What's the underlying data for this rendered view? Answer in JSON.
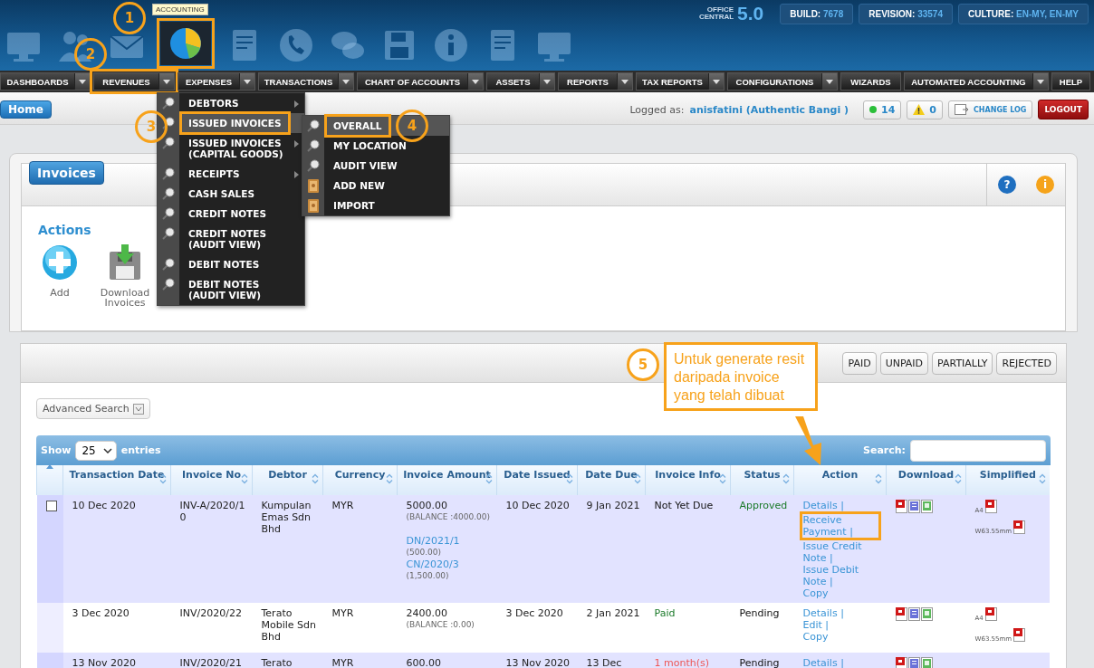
{
  "header": {
    "apps": [
      {
        "kind": "monitor",
        "selected": false
      },
      {
        "kind": "people",
        "selected": false
      },
      {
        "kind": "mail",
        "selected": false
      },
      {
        "kind": "pie",
        "selected": true,
        "tooltip": "ACCOUNTING",
        "outlined": true
      },
      {
        "kind": "document",
        "selected": false
      },
      {
        "kind": "phone",
        "selected": false
      },
      {
        "kind": "chat",
        "selected": false
      },
      {
        "kind": "disk",
        "selected": false
      },
      {
        "kind": "info",
        "selected": false
      },
      {
        "kind": "document",
        "selected": false
      },
      {
        "kind": "monitor",
        "selected": false
      }
    ],
    "product": {
      "line1": "OFFICE",
      "line2": "CENTRAL",
      "version": "5.0"
    },
    "badges": [
      {
        "label": "BUILD:",
        "value": "7678"
      },
      {
        "label": "REVISION:",
        "value": "33574"
      },
      {
        "label": "CULTURE:",
        "value": "EN-MY, EN-MY"
      }
    ]
  },
  "nav": [
    {
      "label": "DASHBOARDS",
      "dropdown": true,
      "outlined": false
    },
    {
      "label": "REVENUES",
      "dropdown": true,
      "outlined": true
    },
    {
      "label": "EXPENSES",
      "dropdown": true,
      "outlined": false
    },
    {
      "label": "TRANSACTIONS",
      "dropdown": true,
      "outlined": false
    },
    {
      "label": "CHART OF ACCOUNTS",
      "dropdown": true,
      "outlined": false
    },
    {
      "label": "ASSETS",
      "dropdown": true,
      "outlined": false
    },
    {
      "label": "REPORTS",
      "dropdown": true,
      "outlined": false
    },
    {
      "label": "TAX REPORTS",
      "dropdown": true,
      "outlined": false
    },
    {
      "label": "CONFIGURATIONS",
      "dropdown": true,
      "outlined": false
    },
    {
      "label": "WIZARDS",
      "dropdown": false,
      "outlined": false
    },
    {
      "label": "AUTOMATED ACCOUNTING",
      "dropdown": true,
      "outlined": false
    },
    {
      "label": "HELP",
      "dropdown": false,
      "outlined": false
    }
  ],
  "revenues_menu": [
    {
      "label": "DEBTORS",
      "submenu": true,
      "highlighted": false,
      "outlined": false
    },
    {
      "label": "ISSUED INVOICES",
      "submenu": false,
      "highlighted": true,
      "outlined": true
    },
    {
      "label": "ISSUED INVOICES (CAPITAL GOODS)",
      "submenu": true,
      "highlighted": false,
      "outlined": false
    },
    {
      "label": "RECEIPTS",
      "submenu": true,
      "highlighted": false,
      "outlined": false
    },
    {
      "label": "CASH SALES",
      "submenu": false,
      "highlighted": false,
      "outlined": false
    },
    {
      "label": "CREDIT NOTES",
      "submenu": false,
      "highlighted": false,
      "outlined": false
    },
    {
      "label": "CREDIT NOTES (AUDIT VIEW)",
      "submenu": false,
      "highlighted": false,
      "outlined": false
    },
    {
      "label": "DEBIT NOTES",
      "submenu": false,
      "highlighted": false,
      "outlined": false
    },
    {
      "label": "DEBIT NOTES (AUDIT VIEW)",
      "submenu": false,
      "highlighted": false,
      "outlined": false
    }
  ],
  "issued_invoices_menu": [
    {
      "label": "OVERALL",
      "kind": "search",
      "highlighted": true,
      "outlined": true
    },
    {
      "label": "MY LOCATION",
      "kind": "search",
      "highlighted": false,
      "outlined": false
    },
    {
      "label": "AUDIT VIEW",
      "kind": "search",
      "highlighted": false,
      "outlined": false
    },
    {
      "label": "ADD NEW",
      "kind": "book",
      "highlighted": false,
      "outlined": false
    },
    {
      "label": "IMPORT",
      "kind": "book",
      "highlighted": false,
      "outlined": false
    }
  ],
  "subbar": {
    "home": "Home",
    "logged_label": "Logged as:",
    "user": "anisfatini (Authentic Bangi )",
    "counters": [
      {
        "kind": "ok",
        "value": "14"
      },
      {
        "kind": "warning",
        "value": "0"
      }
    ],
    "change_log": "CHANGE LOG",
    "logout": "LOGOUT"
  },
  "invoices_panel": {
    "title": "Invoices",
    "help_buttons": [
      {
        "kind": "help",
        "glyph": "?"
      },
      {
        "kind": "info",
        "glyph": "i"
      }
    ],
    "actions_title": "Actions",
    "actions": [
      {
        "kind": "add",
        "label": "Add"
      },
      {
        "kind": "download",
        "label": "Download Invoices"
      }
    ]
  },
  "filters": [
    "PAID",
    "UNPAID",
    "PARTIALLY",
    "REJECTED"
  ],
  "advanced_search": "Advanced Search",
  "table": {
    "show_label": "Show",
    "page_size": "25",
    "entries_label": "entries",
    "search_label": "Search:",
    "columns": [
      "Transaction Date",
      "Invoice No",
      "Debtor",
      "Currency",
      "Invoice Amount",
      "Date Issued",
      "Date Due",
      "Invoice Info",
      "Status",
      "Action",
      "Download",
      "Simplified"
    ],
    "rows": [
      {
        "checked": false,
        "transaction_date": "10 Dec 2020",
        "invoice_no": "INV-A/2020/10",
        "debtor": "Kumpulan Emas Sdn Bhd",
        "currency": "MYR",
        "amount": "5000.00",
        "balance": "(BALANCE :4000.00)",
        "notes": [
          {
            "ref": "DN/2021/1",
            "amount": "(500.00)"
          },
          {
            "ref": "CN/2020/3",
            "amount": "(1,500.00)"
          }
        ],
        "date_issued": "10 Dec 2020",
        "date_due": "9 Jan 2021",
        "info": {
          "text": "Not Yet Due",
          "kind": "due"
        },
        "status": {
          "text": "Approved",
          "kind": "approved"
        },
        "actions": [
          {
            "label": "Details |",
            "outlined": false
          },
          {
            "label": "Receive Payment |",
            "outlined": true
          },
          {
            "label": "Issue Credit Note |",
            "outlined": false
          },
          {
            "label": "Issue Debit Note |",
            "outlined": false
          },
          {
            "label": "Copy",
            "outlined": false
          }
        ],
        "simplified": [
          "A4",
          "W63.55mm"
        ]
      },
      {
        "transaction_date": "3 Dec 2020",
        "invoice_no": "INV/2020/22",
        "debtor": "Terato Mobile Sdn Bhd",
        "currency": "MYR",
        "amount": "2400.00",
        "balance": "(BALANCE :0.00)",
        "date_issued": "3 Dec 2020",
        "date_due": "2 Jan 2021",
        "info": {
          "text": "Paid",
          "kind": "paid"
        },
        "status": {
          "text": "Pending",
          "kind": "pending"
        },
        "actions": [
          {
            "label": "Details |",
            "outlined": false
          },
          {
            "label": "Edit |",
            "outlined": false
          },
          {
            "label": "Copy",
            "outlined": false
          }
        ],
        "simplified": [
          "A4",
          "W63.55mm"
        ]
      },
      {
        "transaction_date": "13 Nov 2020",
        "invoice_no": "INV/2020/21",
        "debtor": "Terato",
        "currency": "MYR",
        "amount": "600.00",
        "date_issued": "13 Nov 2020",
        "date_due": "13 Dec",
        "info": {
          "text": "1 month(s)",
          "kind": "overdue"
        },
        "status": {
          "text": "Pending",
          "kind": "pending"
        },
        "actions": [
          {
            "label": "Details |"
          }
        ]
      }
    ]
  },
  "annotations": [
    {
      "number": "1"
    },
    {
      "number": "2"
    },
    {
      "number": "3"
    },
    {
      "number": "4"
    },
    {
      "number": "5"
    }
  ],
  "callout": {
    "text": "Untuk generate resit daripada invoice yang telah dibuat"
  }
}
